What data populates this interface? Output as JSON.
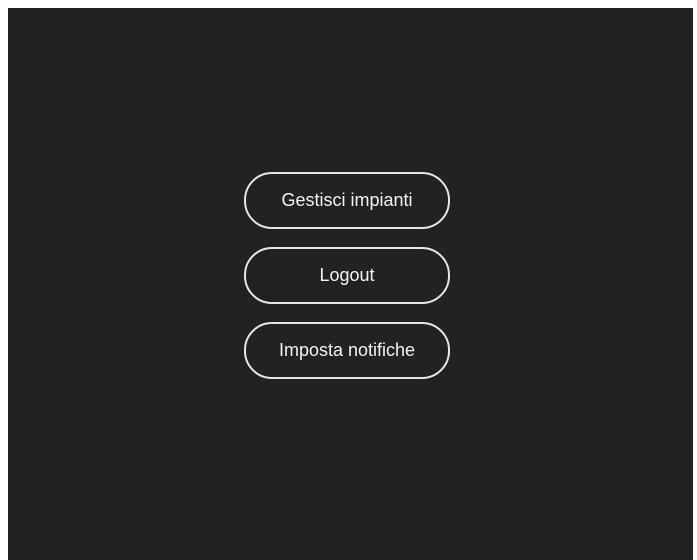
{
  "menu": {
    "items": [
      {
        "label": "Gestisci impianti"
      },
      {
        "label": "Logout"
      },
      {
        "label": "Imposta notifiche"
      }
    ]
  },
  "colors": {
    "background": "#222222",
    "button_border": "#e6e6e6",
    "button_text": "#f2f2f2"
  }
}
